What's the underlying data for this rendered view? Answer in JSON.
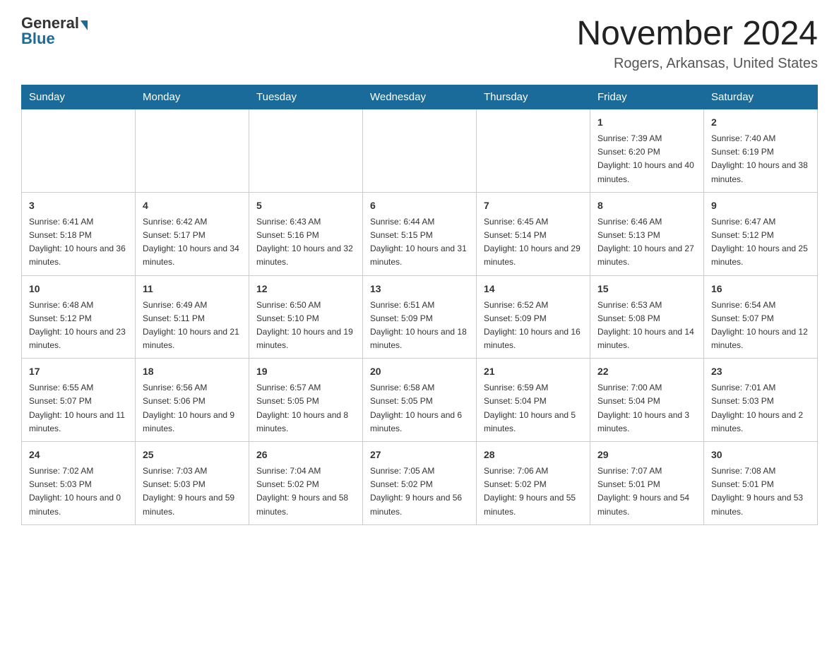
{
  "logo": {
    "general": "General",
    "blue": "Blue"
  },
  "title": "November 2024",
  "location": "Rogers, Arkansas, United States",
  "days_header": [
    "Sunday",
    "Monday",
    "Tuesday",
    "Wednesday",
    "Thursday",
    "Friday",
    "Saturday"
  ],
  "weeks": [
    [
      {
        "day": "",
        "info": ""
      },
      {
        "day": "",
        "info": ""
      },
      {
        "day": "",
        "info": ""
      },
      {
        "day": "",
        "info": ""
      },
      {
        "day": "",
        "info": ""
      },
      {
        "day": "1",
        "info": "Sunrise: 7:39 AM\nSunset: 6:20 PM\nDaylight: 10 hours and 40 minutes."
      },
      {
        "day": "2",
        "info": "Sunrise: 7:40 AM\nSunset: 6:19 PM\nDaylight: 10 hours and 38 minutes."
      }
    ],
    [
      {
        "day": "3",
        "info": "Sunrise: 6:41 AM\nSunset: 5:18 PM\nDaylight: 10 hours and 36 minutes."
      },
      {
        "day": "4",
        "info": "Sunrise: 6:42 AM\nSunset: 5:17 PM\nDaylight: 10 hours and 34 minutes."
      },
      {
        "day": "5",
        "info": "Sunrise: 6:43 AM\nSunset: 5:16 PM\nDaylight: 10 hours and 32 minutes."
      },
      {
        "day": "6",
        "info": "Sunrise: 6:44 AM\nSunset: 5:15 PM\nDaylight: 10 hours and 31 minutes."
      },
      {
        "day": "7",
        "info": "Sunrise: 6:45 AM\nSunset: 5:14 PM\nDaylight: 10 hours and 29 minutes."
      },
      {
        "day": "8",
        "info": "Sunrise: 6:46 AM\nSunset: 5:13 PM\nDaylight: 10 hours and 27 minutes."
      },
      {
        "day": "9",
        "info": "Sunrise: 6:47 AM\nSunset: 5:12 PM\nDaylight: 10 hours and 25 minutes."
      }
    ],
    [
      {
        "day": "10",
        "info": "Sunrise: 6:48 AM\nSunset: 5:12 PM\nDaylight: 10 hours and 23 minutes."
      },
      {
        "day": "11",
        "info": "Sunrise: 6:49 AM\nSunset: 5:11 PM\nDaylight: 10 hours and 21 minutes."
      },
      {
        "day": "12",
        "info": "Sunrise: 6:50 AM\nSunset: 5:10 PM\nDaylight: 10 hours and 19 minutes."
      },
      {
        "day": "13",
        "info": "Sunrise: 6:51 AM\nSunset: 5:09 PM\nDaylight: 10 hours and 18 minutes."
      },
      {
        "day": "14",
        "info": "Sunrise: 6:52 AM\nSunset: 5:09 PM\nDaylight: 10 hours and 16 minutes."
      },
      {
        "day": "15",
        "info": "Sunrise: 6:53 AM\nSunset: 5:08 PM\nDaylight: 10 hours and 14 minutes."
      },
      {
        "day": "16",
        "info": "Sunrise: 6:54 AM\nSunset: 5:07 PM\nDaylight: 10 hours and 12 minutes."
      }
    ],
    [
      {
        "day": "17",
        "info": "Sunrise: 6:55 AM\nSunset: 5:07 PM\nDaylight: 10 hours and 11 minutes."
      },
      {
        "day": "18",
        "info": "Sunrise: 6:56 AM\nSunset: 5:06 PM\nDaylight: 10 hours and 9 minutes."
      },
      {
        "day": "19",
        "info": "Sunrise: 6:57 AM\nSunset: 5:05 PM\nDaylight: 10 hours and 8 minutes."
      },
      {
        "day": "20",
        "info": "Sunrise: 6:58 AM\nSunset: 5:05 PM\nDaylight: 10 hours and 6 minutes."
      },
      {
        "day": "21",
        "info": "Sunrise: 6:59 AM\nSunset: 5:04 PM\nDaylight: 10 hours and 5 minutes."
      },
      {
        "day": "22",
        "info": "Sunrise: 7:00 AM\nSunset: 5:04 PM\nDaylight: 10 hours and 3 minutes."
      },
      {
        "day": "23",
        "info": "Sunrise: 7:01 AM\nSunset: 5:03 PM\nDaylight: 10 hours and 2 minutes."
      }
    ],
    [
      {
        "day": "24",
        "info": "Sunrise: 7:02 AM\nSunset: 5:03 PM\nDaylight: 10 hours and 0 minutes."
      },
      {
        "day": "25",
        "info": "Sunrise: 7:03 AM\nSunset: 5:03 PM\nDaylight: 9 hours and 59 minutes."
      },
      {
        "day": "26",
        "info": "Sunrise: 7:04 AM\nSunset: 5:02 PM\nDaylight: 9 hours and 58 minutes."
      },
      {
        "day": "27",
        "info": "Sunrise: 7:05 AM\nSunset: 5:02 PM\nDaylight: 9 hours and 56 minutes."
      },
      {
        "day": "28",
        "info": "Sunrise: 7:06 AM\nSunset: 5:02 PM\nDaylight: 9 hours and 55 minutes."
      },
      {
        "day": "29",
        "info": "Sunrise: 7:07 AM\nSunset: 5:01 PM\nDaylight: 9 hours and 54 minutes."
      },
      {
        "day": "30",
        "info": "Sunrise: 7:08 AM\nSunset: 5:01 PM\nDaylight: 9 hours and 53 minutes."
      }
    ]
  ]
}
